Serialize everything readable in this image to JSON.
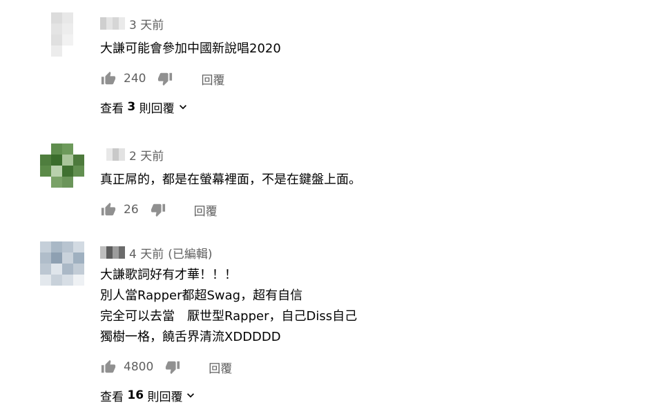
{
  "comments": [
    {
      "timestamp": "3 天前",
      "edited": "",
      "text_lines": [
        "大謙可能會參加中國新說唱2020"
      ],
      "likes": "240",
      "reply_label": "回覆",
      "view_replies": {
        "prefix": "查看",
        "count": "3",
        "suffix": "則回覆"
      },
      "avatar_colors": [
        "#ffffff",
        "#dcdcdc",
        "#e8e8e8",
        "#ffffff",
        "#ffffff",
        "#e4e4e4",
        "#ededed",
        "#ffffff",
        "#ffffff",
        "#e0e0e0",
        "#f2f2f2",
        "#ffffff",
        "#ffffff",
        "#ececec",
        "#ffffff",
        "#ffffff"
      ],
      "name_blur_colors": [
        "#cfcfcf",
        "#e4e4e4",
        "#d6d6d6",
        "#eaeaea"
      ]
    },
    {
      "timestamp": "2 天前",
      "edited": "",
      "text_lines": [
        "真正屌的，都是在螢幕裡面，不是在鍵盤上面。"
      ],
      "likes": "26",
      "reply_label": "回覆",
      "view_replies": null,
      "avatar_colors": [
        "#ffffff",
        "#5f8d4e",
        "#6d9a5b",
        "#ffffff",
        "#4f7e3e",
        "#3a6d2c",
        "#a9c59a",
        "#4d7a3c",
        "#5b8a48",
        "#b9d1ad",
        "#3f7030",
        "#628f50",
        "#ffffff",
        "#7aa268",
        "#6b955a",
        "#ffffff"
      ],
      "name_blur_colors": [
        "#ffffff",
        "#e8e8e8",
        "#c9c9c9",
        "#e2e2e2"
      ]
    },
    {
      "timestamp": "4 天前",
      "edited": "(已編輯)",
      "text_lines": [
        "大謙歌詞好有才華！！！",
        "別人當Rapper都超Swag，超有自信",
        "完全可以去當　厭世型Rapper，自己Diss自己",
        "獨樹一格，饒舌界清流XDDDDD"
      ],
      "likes": "4800",
      "reply_label": "回覆",
      "view_replies": {
        "prefix": "查看",
        "count": "16",
        "suffix": "則回覆"
      },
      "avatar_colors": [
        "#c5cfd9",
        "#a9b8c6",
        "#b8c4d0",
        "#d2dae2",
        "#b0bdca",
        "#8ea0b2",
        "#c9d2db",
        "#9fb0c0",
        "#bcc7d2",
        "#dfe5eb",
        "#aab8c6",
        "#c2ccd6",
        "#e3e8ed",
        "#c8d1da",
        "#d7dee5",
        "#eef1f4"
      ],
      "name_blur_colors": [
        "#bdbdbd",
        "#5d5d5d",
        "#9c9c9c",
        "#6b6b6b"
      ]
    }
  ],
  "colors": {
    "secondary_text": "#606060",
    "primary_text": "#030303",
    "icon": "#909090"
  },
  "icons": {
    "like": "thumb-up-icon",
    "dislike": "thumb-down-icon",
    "expand": "chevron-down-icon"
  }
}
